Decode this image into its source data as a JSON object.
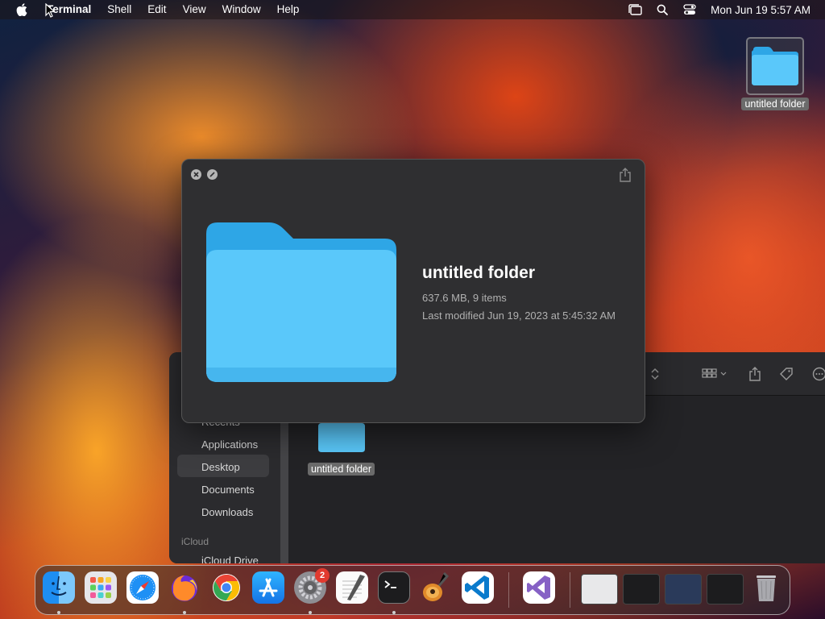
{
  "menubar": {
    "app_name": "Terminal",
    "menus": [
      "Shell",
      "Edit",
      "View",
      "Window",
      "Help"
    ],
    "clock": "Mon Jun 19  5:57 AM"
  },
  "desktop": {
    "folder_label": "untitled folder"
  },
  "finder": {
    "sidebar_items": [
      "Recents",
      "Applications",
      "Desktop",
      "Documents",
      "Downloads"
    ],
    "sidebar_header_icloud": "iCloud",
    "sidebar_icloud_item": "iCloud Drive",
    "selected_item": "Desktop",
    "folder_label": "untitled folder"
  },
  "quicklook": {
    "title": "untitled folder",
    "size_items": "637.6 MB, 9 items",
    "modified": "Last modified Jun 19, 2023 at 5:45:32 AM"
  },
  "dock": {
    "apps": [
      "finder-icon",
      "launchpad-icon",
      "safari-icon",
      "firefox-icon",
      "chrome-icon",
      "app-store-icon",
      "system-settings-icon",
      "textedit-icon",
      "terminal-icon",
      "garageband-icon",
      "vscode-icon",
      "visual-studio-icon"
    ],
    "settings_badge": "2"
  },
  "colors": {
    "folder_blue": "#5ac8fa",
    "folder_blue_dark": "#2ea6e6",
    "badge_red": "#e23a2f"
  }
}
